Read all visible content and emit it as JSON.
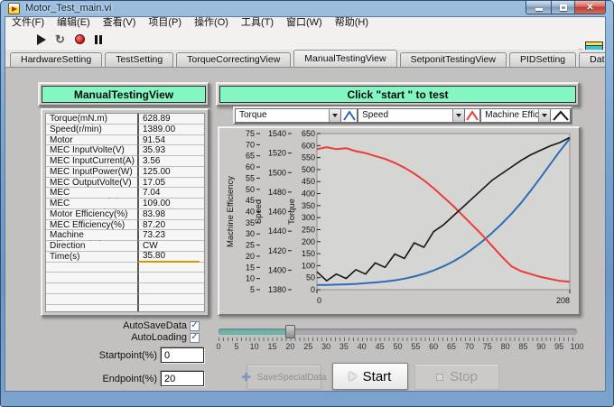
{
  "window": {
    "title": "Motor_Test_main.vi"
  },
  "menu": {
    "items": [
      "文件(F)",
      "编辑(E)",
      "查看(V)",
      "项目(P)",
      "操作(O)",
      "工具(T)",
      "窗口(W)",
      "帮助(H)"
    ]
  },
  "toolbar": {
    "icons": [
      "run",
      "run-continuously",
      "abort",
      "pause"
    ],
    "help_label": "?"
  },
  "tabs": {
    "active": "ManualTestingView",
    "items": [
      "HardwareSetting",
      "TestSetting",
      "TorqueCorrectingView",
      "ManualTestingView",
      "SetponitTestingView",
      "PIDSetting",
      "Data and Curve"
    ]
  },
  "left_panel": {
    "title": "ManualTestingView",
    "rows": [
      {
        "label": "Torque(mN.m)",
        "value": "628.89"
      },
      {
        "label": "Speed(r/min)",
        "value": "1389.00"
      },
      {
        "label": "Motor OutputPower(W)",
        "value": "91.54"
      },
      {
        "label": "MEC InputVolte(V)",
        "value": "35.93"
      },
      {
        "label": "MEC InputCurrent(A)",
        "value": "3.56"
      },
      {
        "label": "MEC InputPower(W)",
        "value": "125.00"
      },
      {
        "label": "MEC OutputVolte(V)",
        "value": "17.05"
      },
      {
        "label": "MEC OutputCurrent(A)",
        "value": "7.04"
      },
      {
        "label": "MEC OutputPower(W)",
        "value": "109.00"
      },
      {
        "label": "Motor Efficiency(%)",
        "value": "83.98"
      },
      {
        "label": "MEC Efficiency(%)",
        "value": "87.20"
      },
      {
        "label": "Machine Efficiency(%)",
        "value": "73.23"
      },
      {
        "label": "Direction",
        "value": "CW"
      },
      {
        "label": "Time(s)",
        "value": "35.80"
      }
    ],
    "empty_rows": 5,
    "underline_after_label": "Time(s)"
  },
  "right_panel": {
    "status": "Click \"start \" to test"
  },
  "legend": [
    {
      "label": "Torque",
      "color": "#2e6db4"
    },
    {
      "label": "Speed",
      "color": "#ef3b36"
    },
    {
      "label": "Machine Efficiency",
      "color": "#141414"
    }
  ],
  "chart_data": {
    "type": "line",
    "plot_bg": "#d5d5d4",
    "grid": false,
    "legend_position": "top",
    "x_axis": {
      "range": [
        0,
        208
      ],
      "tick_labels": [
        "0",
        "208"
      ]
    },
    "y_axes": [
      {
        "name": "Machine Efficiency",
        "range": [
          5,
          75
        ],
        "tick_step": 5
      },
      {
        "name": "Speed",
        "range": [
          1380,
          1540
        ],
        "tick_step": 20
      },
      {
        "name": "Torque",
        "range": [
          0,
          650
        ],
        "tick_step": 50
      }
    ],
    "x_points": [
      0,
      8,
      16,
      24,
      32,
      40,
      48,
      56,
      64,
      72,
      80,
      88,
      96,
      104,
      112,
      120,
      128,
      136,
      144,
      152,
      160,
      168,
      176,
      184,
      192,
      200,
      208
    ],
    "series": [
      {
        "name": "Torque",
        "axis": "Torque",
        "color": "#2e6db4",
        "width": 2,
        "values": [
          20,
          20,
          21,
          22,
          24,
          27,
          30,
          34,
          39,
          46,
          55,
          66,
          80,
          97,
          117,
          141,
          170,
          201,
          236,
          274,
          316,
          362,
          413,
          467,
          523,
          578,
          629
        ]
      },
      {
        "name": "Speed",
        "axis": "Speed",
        "color": "#ef3b36",
        "width": 2,
        "values": [
          1524,
          1526,
          1524,
          1525,
          1522,
          1520,
          1517,
          1514,
          1510,
          1505,
          1499,
          1492,
          1484,
          1475,
          1466,
          1456,
          1446,
          1436,
          1425,
          1414,
          1404,
          1399,
          1396,
          1393,
          1391,
          1389,
          1388
        ]
      },
      {
        "name": "Machine Efficiency",
        "axis": "Machine Efficiency",
        "color": "#141414",
        "width": 1.6,
        "values": [
          13,
          9,
          12,
          10,
          14,
          12,
          17,
          15,
          21,
          19,
          26,
          24,
          31,
          34,
          38,
          42,
          46,
          50,
          54,
          57,
          60,
          63,
          65.5,
          67.5,
          69.5,
          71,
          73.2
        ]
      }
    ]
  },
  "controls": {
    "autosave_label": "AutoSaveData",
    "autosave_checked": true,
    "autoload_label": "AutoLoading",
    "autoload_checked": true,
    "startpoint_label": "Startpoint(%)",
    "startpoint_value": "0",
    "endpoint_label": "Endpoint(%)",
    "endpoint_value": "20",
    "slider": {
      "min": 0,
      "max": 100,
      "value": 20,
      "label_step": 5,
      "fill_color": "#74b2aa"
    },
    "check_glyph": "✓"
  },
  "buttons": {
    "save_label": "SaveSpecialData",
    "start_label": "Start",
    "stop_label": "Stop"
  }
}
